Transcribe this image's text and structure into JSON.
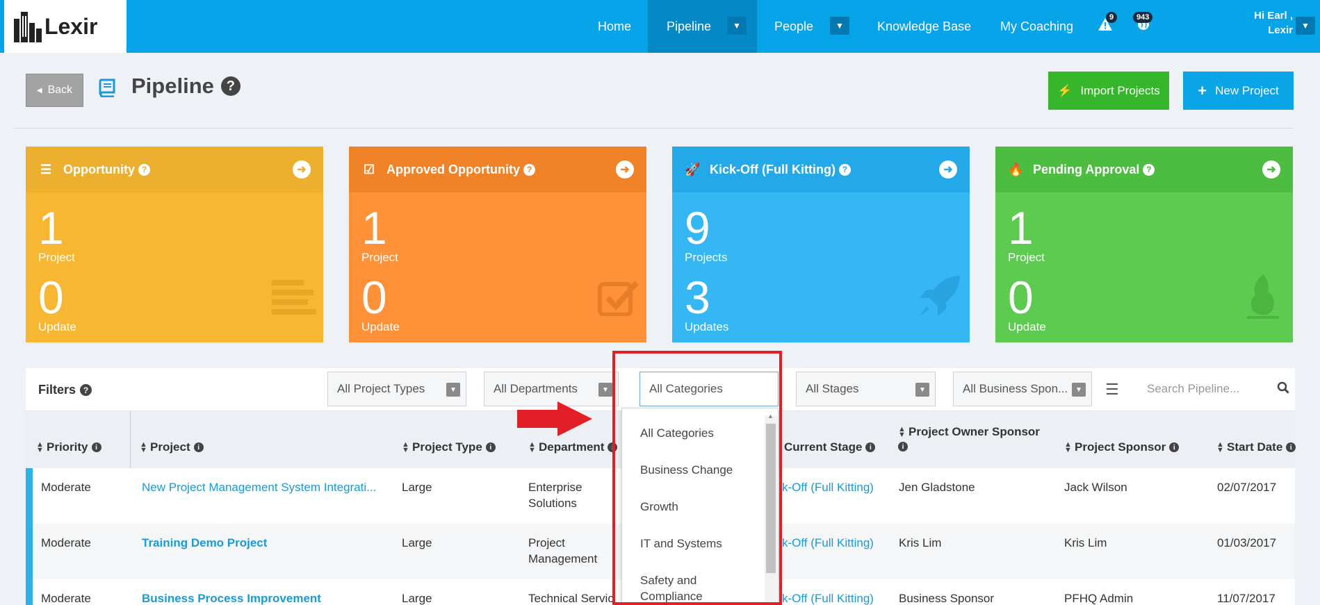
{
  "nav": {
    "logo_text": "Lexir",
    "items": [
      {
        "label": "Home"
      },
      {
        "label": "Pipeline"
      },
      {
        "label": "People"
      },
      {
        "label": "Knowledge Base"
      },
      {
        "label": "My Coaching"
      }
    ],
    "alerts_count": "9",
    "notifications_count": "943",
    "greeting_line1": "Hi Earl ,",
    "greeting_line2": "Lexir",
    "brand_color": "#05a3e8"
  },
  "header": {
    "back_label": "Back",
    "title": "Pipeline",
    "import_label": "Import Projects",
    "new_label": "New Project"
  },
  "cards": [
    {
      "title": "Opportunity",
      "count": "1",
      "count_label": "Project",
      "updates": "0",
      "updates_label": "Update",
      "color": "#f7b733",
      "head_color": "#ecb02e",
      "icon": "align-left-icon"
    },
    {
      "title": "Approved Opportunity",
      "count": "1",
      "count_label": "Project",
      "updates": "0",
      "updates_label": "Update",
      "color": "#ff9138",
      "head_color": "#f08328",
      "icon": "check-square-icon"
    },
    {
      "title": "Kick-Off (Full Kitting)",
      "count": "9",
      "count_label": "Projects",
      "updates": "3",
      "updates_label": "Updates",
      "color": "#35b7f3",
      "head_color": "#23a9ea",
      "icon": "rocket-icon"
    },
    {
      "title": "Pending Approval",
      "count": "1",
      "count_label": "Project",
      "updates": "0",
      "updates_label": "Update",
      "color": "#5ccb4f",
      "head_color": "#4cbd40",
      "icon": "fire-icon"
    }
  ],
  "filters": {
    "label": "Filters",
    "project_types": "All Project Types",
    "departments": "All Departments",
    "categories": "All Categories",
    "stages": "All Stages",
    "business_sponsor": "All Business Spon...",
    "search_placeholder": "Search Pipeline..."
  },
  "category_options": [
    "All Categories",
    "Business Change",
    "Growth",
    "IT and Systems",
    "Safety and Compliance"
  ],
  "table": {
    "headers": {
      "priority": "Priority",
      "project": "Project",
      "project_type": "Project Type",
      "department": "Department",
      "current_stage": "Current Stage",
      "owner_sponsor": "Project Owner Sponsor",
      "project_sponsor": "Project Sponsor",
      "start_date": "Start Date"
    },
    "rows": [
      {
        "priority": "Moderate",
        "project": "New Project Management System Integrati...",
        "type": "Large",
        "department": "Enterprise Solutions",
        "stage": "k-Off (Full Kitting)",
        "owner": "Jen Gladstone",
        "sponsor": "Jack Wilson",
        "start": "02/07/2017"
      },
      {
        "priority": "Moderate",
        "project": "Training Demo Project",
        "type": "Large",
        "department": "Project Management",
        "stage": "k-Off (Full Kitting)",
        "owner": "Kris Lim",
        "sponsor": "Kris Lim",
        "start": "01/03/2017"
      },
      {
        "priority": "Moderate",
        "project": "Business Process Improvement",
        "type": "Large",
        "department": "Technical Servic",
        "stage": "k-Off (Full Kitting)",
        "owner": "Business Sponsor",
        "sponsor": "PFHQ Admin",
        "start": "11/07/2017"
      }
    ]
  }
}
